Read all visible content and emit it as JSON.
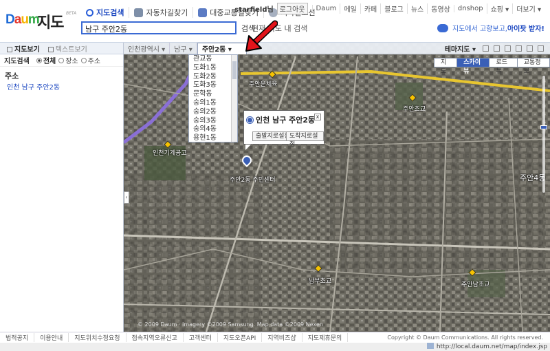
{
  "header": {
    "logo_daum": [
      "D",
      "a",
      "u",
      "m"
    ],
    "logo_jido": "지도",
    "logo_beta": "BETA",
    "tabs": [
      {
        "label": "지도검색",
        "icon": "search-icon",
        "active": true
      },
      {
        "label": "자동차길찾기",
        "icon": "car-icon",
        "active": false
      },
      {
        "label": "대중교통길찾기",
        "icon": "bus-icon",
        "active": false
      },
      {
        "label": "지하철노선",
        "icon": "subway-icon",
        "active": false
      }
    ],
    "search_value": "남구 주안2동",
    "search_button": "검색",
    "search_option": "현재 지도 내 검색",
    "user": "starfield님",
    "logout": "로그아웃",
    "menu": [
      "Daum",
      "메일",
      "카페",
      "블로그",
      "뉴스",
      "동영상",
      "dnshop",
      "쇼핑 ▾",
      "더보기 ▾"
    ],
    "promo_prefix": "지도에서 고향보고,",
    "promo_bold": "아이팟 받자!"
  },
  "left": {
    "tab_map": "지도보기",
    "tab_text": "텍스트보기",
    "search_title": "지도검색",
    "radios": [
      "전체",
      "장소",
      "주소"
    ],
    "address_label": "주소",
    "result": "인천 남구 주안2동"
  },
  "mapbar": {
    "crumbs": [
      "인천광역시 ▾",
      "남구 ▾"
    ],
    "selected": "주안2동 ▾",
    "thema": "테마지도 ▾"
  },
  "dropdown": {
    "options": [
      "관교동",
      "도화1동",
      "도화2동",
      "도화3동",
      "문학동",
      "숭의1동",
      "숭의2동",
      "숭의3동",
      "숭의4동",
      "용현1동"
    ]
  },
  "map_types": [
    "지도",
    "스카이뷰",
    "로드뷰",
    "교통정보"
  ],
  "active_map_type": "스카이뷰",
  "infowindow": {
    "title": "인천 남구 주안2동",
    "close": "x",
    "btn_start": "출발지로설정",
    "btn_end": "도착지로설정"
  },
  "map_labels": {
    "gym": "주안운체육",
    "school1": "주안초교",
    "park": "인천기계공고",
    "center": "주안2동 주민센터",
    "dong4": "주안4동",
    "school2": "남부초교",
    "school3": "주안남초교"
  },
  "map_copyright": "© 2009 Daum · Imagery ©2009 Samsung. Map data ©2009 Nexen",
  "footer": {
    "links": [
      "법적공지",
      "이용안내",
      "지도위치수정요청",
      "접속지역오류신고",
      "고객센터",
      "지도오픈API",
      "지역비즈샵",
      "지도제휴문의"
    ],
    "copyright": "Copyright © Daum Communications. All rights reserved."
  },
  "status_url": "http://local.daum.net/map/index.jsp",
  "colors": {
    "accent": "#3a5fb6",
    "brand_blue": "#1a46c0",
    "arrow_red": "#e2141b",
    "road_yellow": "#e8c630",
    "road_purple": "#8a6fd6"
  }
}
